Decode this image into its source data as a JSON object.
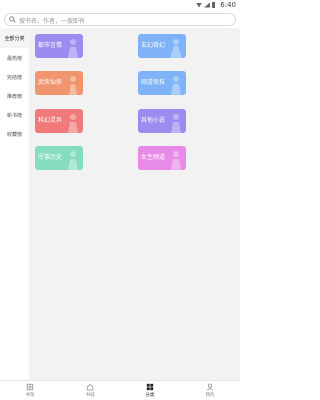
{
  "status_bar": {
    "time": "6:40"
  },
  "search": {
    "placeholder": "搜书名、作者，一搜即有"
  },
  "sidebar": {
    "items": [
      {
        "label": "全部分类",
        "active": true
      },
      {
        "label": "最热榜",
        "active": false
      },
      {
        "label": "完结榜",
        "active": false
      },
      {
        "label": "推荐榜",
        "active": false
      },
      {
        "label": "新书榜",
        "active": false
      },
      {
        "label": "收藏榜",
        "active": false
      }
    ]
  },
  "categories": [
    {
      "label": "都市言情",
      "color": "#9b8cf0"
    },
    {
      "label": "玄幻奇幻",
      "color": "#7fb2f7"
    },
    {
      "label": "武侠仙侠",
      "color": "#f0956e"
    },
    {
      "label": "网游竞技",
      "color": "#7fb2f7"
    },
    {
      "label": "科幻灵异",
      "color": "#f07a7a"
    },
    {
      "label": "其他小说",
      "color": "#9b8cf0"
    },
    {
      "label": "军事历史",
      "color": "#86dcc0"
    },
    {
      "label": "女生频道",
      "color": "#e88ae8"
    }
  ],
  "tabbar": {
    "items": [
      {
        "label": "书架",
        "icon": "bookshelf-icon",
        "active": false
      },
      {
        "label": "书城",
        "icon": "home-icon",
        "active": false
      },
      {
        "label": "分类",
        "icon": "category-grid-icon",
        "active": true
      },
      {
        "label": "我的",
        "icon": "person-icon",
        "active": false
      }
    ]
  }
}
